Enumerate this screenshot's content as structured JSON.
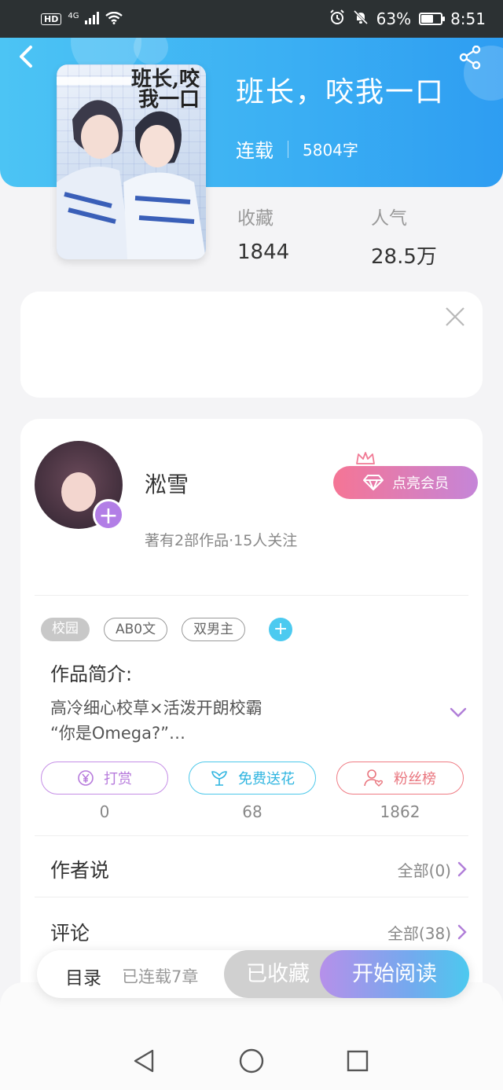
{
  "status_bar": {
    "hd": "HD",
    "network": "4G",
    "battery_percent": "63%",
    "battery_level": 0.63,
    "time": "8:51"
  },
  "header": {
    "book_title": "班长，咬我一口",
    "status": "连载",
    "word_count": "5804字",
    "cover_title": "班长,咬我一口"
  },
  "stats": [
    {
      "label": "收藏",
      "value": "1844"
    },
    {
      "label": "人气",
      "value": "28.5万"
    }
  ],
  "author": {
    "name": "淞雪",
    "subtitle": "著有2部作品·15人关注",
    "vip_button": "点亮会员"
  },
  "tags": [
    "校园",
    "AB0文",
    "双男主"
  ],
  "intro": {
    "title": "作品简介:",
    "line1": "高冷细心校草×活泼开朗校霸",
    "line2": "“你是Omega?”…"
  },
  "actions": [
    {
      "label": "打赏",
      "count": "0",
      "icon": "yen-coin-icon"
    },
    {
      "label": "免费送花",
      "count": "68",
      "icon": "flower-icon"
    },
    {
      "label": "粉丝榜",
      "count": "1862",
      "icon": "user-heart-icon"
    }
  ],
  "author_says": {
    "title": "作者说",
    "link": "全部(0)"
  },
  "comments": {
    "title": "评论",
    "link": "全部(38)"
  },
  "bottom_bar": {
    "toc": "目录",
    "chapters": "已连载7章",
    "collected": "已收藏",
    "read": "开始阅读"
  },
  "colors": {
    "header_blue": "#3aaef3",
    "vip_pink": "#f57595",
    "accent_purple": "#b27ee6",
    "accent_cyan": "#4cc8ea"
  }
}
